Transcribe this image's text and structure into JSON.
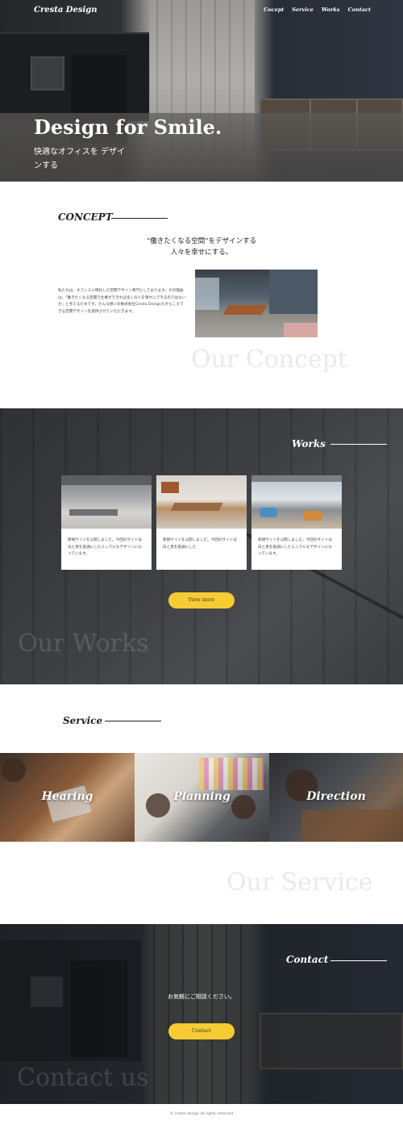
{
  "header": {
    "logo": "Cresta Design",
    "nav": [
      "Cocept",
      "Service",
      "Works",
      "Contact"
    ]
  },
  "hero": {
    "title": "Design for Smile.",
    "subtitle": "快適なオフィスを デザインする"
  },
  "concept": {
    "heading": "CONCEPT",
    "catch_line1": "“働きたくなる空間”をデザインする",
    "catch_line2": "人々を幸せにする。",
    "body": "私たちは、オフィスに特化した空間デザイン専門としております。その理由は、「働きたくなる空間で仕事ができれば多くの人を幸せにできるのではないか」と考えるためです。そんな想いの株式会社Cresta Designだからこそできる空間デザインを提供させていただきます。",
    "ghost": "Our Concept"
  },
  "works": {
    "heading": "Works",
    "cards": [
      {
        "text": "新規サイトを公開しました。今回のサイトは白と黒を基調にしたミニマルなデザインになっています。"
      },
      {
        "text": "新規サイトを公開しました。今回のサイトは白と黒を基調にした"
      },
      {
        "text": "新規サイトを公開しました。今回のサイトは白と黒を基調にしたミニマルなデザインになっています。"
      }
    ],
    "view_more": "View more",
    "ghost": "Our Works"
  },
  "service": {
    "heading": "Service",
    "items": [
      "Hearing",
      "Planning",
      "Direction"
    ],
    "ghost": "Our Service"
  },
  "contact": {
    "heading": "Contact",
    "message": "お気軽にご相談ください。",
    "button": "Contact",
    "ghost": "Contact us"
  },
  "footer": {
    "copyright": "© cresta design all rights reserved"
  },
  "colors": {
    "accent": "#f7cb33",
    "dark": "#2f3135"
  }
}
